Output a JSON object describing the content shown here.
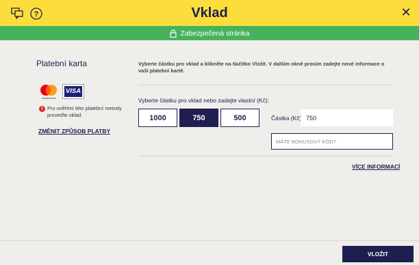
{
  "header": {
    "title": "Vklad",
    "icons": [
      "chat-icon",
      "help-icon",
      "close-icon"
    ],
    "close_glyph": "✕",
    "bg_color": "#fbde3c"
  },
  "secure_bar": {
    "text": "Zabezpečená stránka",
    "icon": "lock-icon",
    "bg_color": "#46b35c"
  },
  "payment_method": {
    "title": "Platební karta",
    "cards": [
      "mastercard",
      "VISA"
    ],
    "visa_label": "VISA",
    "warning_icon": "!",
    "warning_text": "Pro ověření této platební metody proveďte vklad.",
    "change_link": "ZMĚNIT ZPŮSOB PLATBY"
  },
  "deposit": {
    "instructions": "Vyberte částku pro vklad a klikněte na tlačítko Vložit. V dalším okně prosím zadejte nové informace o vaší platební kartě.",
    "amount_label": "Vyberte částku pro vklad nebo zadejte vlastní (Kč):",
    "amount_options": [
      "1000",
      "750",
      "500"
    ],
    "selected_amount": "750",
    "castka_label": "Částka (Kč):",
    "castka_value": "750",
    "bonus_placeholder": "MÁTE BONUSOVÝ KÓD?",
    "more_info": "VÍCE INFORMACÍ"
  },
  "footer": {
    "submit_label": "VLOŽIT"
  },
  "colors": {
    "primary": "#1e1e50",
    "background": "#efeeeb"
  }
}
